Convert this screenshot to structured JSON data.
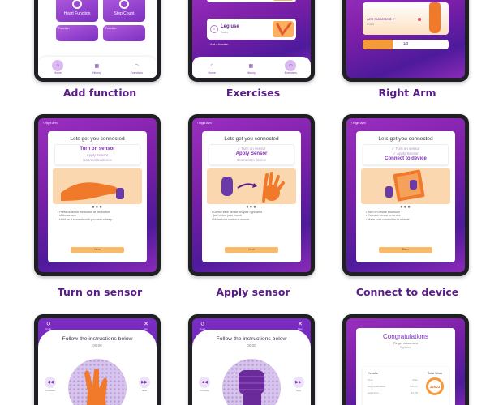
{
  "captions": {
    "add_function": "Add function",
    "exercises": "Exercises",
    "right_arm": "Right Arm",
    "turn_on_sensor": "Turn on sensor",
    "apply_sensor": "Apply sensor",
    "connect_device": "Connect to device"
  },
  "add_function_screen": {
    "tiles": [
      "Heart Function",
      "Step Count",
      "Function",
      "Function"
    ],
    "nav": [
      "Home",
      "History",
      "Exercises"
    ]
  },
  "exercises_screen": {
    "card_title": "Leg use",
    "card_sub": "Tasks",
    "add_label": "Add a function",
    "nav": [
      "Home",
      "History",
      "Exercises"
    ]
  },
  "right_arm_screen": {
    "movement_label": "Arm movement ✓",
    "movement_sub": "Details",
    "progress": "1/3"
  },
  "connection": {
    "back_label": "Right Arm",
    "title": "Lets  get you connected",
    "steps": [
      "Turn on sensor",
      "Apply Sensor",
      "Connect to device"
    ],
    "next": "Next",
    "done": "Done",
    "turn_on_bullets": [
      "Press down on the button at the bottom",
      "of the sensor",
      "Hold for 5 seconds until you hear a beep"
    ],
    "apply_bullets": [
      "Gently stick sensor on your right wrist",
      "just below your thumb",
      "Make sure sensor is secure"
    ],
    "connect_bullets": [
      "Turn on device Bluetooth",
      "Connect sensor to device",
      "Make sure connection is reliable"
    ]
  },
  "instructions": {
    "undo": "Undo",
    "stop": "Stop",
    "title": "Follow the instructions below",
    "time": "00:00",
    "previous": "Previous",
    "next": "Next"
  },
  "congrats": {
    "title": "Congratulations",
    "sub": "Finger movement",
    "arm": "Right Arm",
    "results": "Results",
    "total_work": "Total Work",
    "rows": [
      {
        "label": "Time",
        "value": "3min"
      },
      {
        "label": "Avg Acceleration",
        "value": "0.8m/s²"
      },
      {
        "label": "Avg Force",
        "value": "10.0N"
      }
    ],
    "total_value": "3200J"
  },
  "colors": {
    "brand_purple": "#7b1fa8",
    "accent_orange": "#fbb96a",
    "caption": "#5a1d88"
  }
}
